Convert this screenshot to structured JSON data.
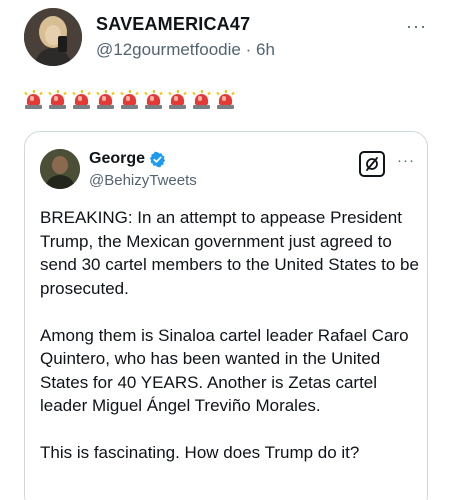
{
  "post": {
    "author_name": "SAVEAMERICA47",
    "handle": "@12gourmetfoodie",
    "separator": "·",
    "time": "6h",
    "more": "···",
    "emoji_row": [
      "siren",
      "siren",
      "siren",
      "siren",
      "siren",
      "siren",
      "siren",
      "siren",
      "siren"
    ]
  },
  "quote": {
    "author_name": "George",
    "handle": "@BehizyTweets",
    "more": "···",
    "paragraphs": [
      "BREAKING: In an attempt to appease President Trump, the Mexican government just agreed to send 30 cartel members to the United States to be prosecuted.",
      "Among them is Sinaloa cartel leader Rafael Caro Quintero, who has been wanted in the United States for 40 YEARS. Another is Zetas cartel leader Miguel Ángel Treviño Morales.",
      "This is fascinating. How does Trump do it?"
    ]
  },
  "colors": {
    "text": "#0f1419",
    "secondary": "#536471",
    "border": "#cfd9de",
    "verified": "#1d9bf0",
    "siren_red": "#e53935"
  },
  "icons": {
    "verified": "verified-badge-icon",
    "grok": "grok-icon",
    "siren": "police-light-emoji"
  }
}
